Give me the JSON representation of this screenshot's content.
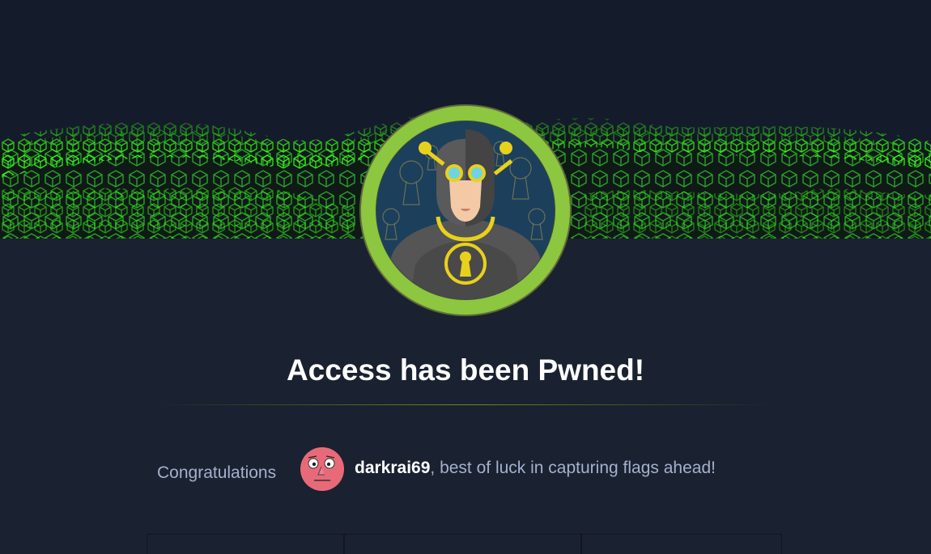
{
  "pwn": {
    "title": "Access has been Pwned!",
    "congrats_label": "Congratulations",
    "username": "darkrai69",
    "message_suffix": ", best of luck in capturing flags ahead!"
  },
  "icons": {
    "machine_avatar": "masked-figure-keys-icon",
    "user_avatar": "pink-face-avatar-icon"
  },
  "colors": {
    "background": "#1a2130",
    "header_background": "#141c2b",
    "accent_green": "#9fef00",
    "avatar_ring": "#8dc63f",
    "text_muted": "#a4b1cd",
    "text_white": "#ffffff"
  }
}
